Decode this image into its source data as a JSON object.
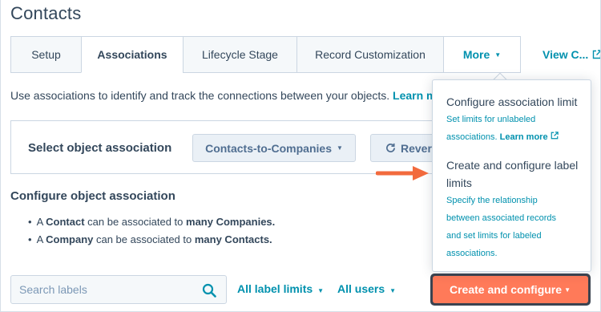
{
  "page": {
    "title": "Contacts"
  },
  "tabs": [
    {
      "label": "Setup"
    },
    {
      "label": "Associations"
    },
    {
      "label": "Lifecycle Stage"
    },
    {
      "label": "Record Customization"
    },
    {
      "label": "More"
    }
  ],
  "view_tab": {
    "label": "View C..."
  },
  "description": {
    "text": "Use associations to identify and track the connections between your objects.",
    "link": "Learn mor"
  },
  "select_association": {
    "label": "Select object association",
    "dropdown_value": "Contacts-to-Companies",
    "reverse_label": "Revers"
  },
  "configure": {
    "title": "Configure object association",
    "bullets": [
      {
        "prefix": "A ",
        "subject": "Contact",
        "middle": " can be associated to ",
        "object": "many Companies."
      },
      {
        "prefix": "A ",
        "subject": "Company",
        "middle": " can be associated to ",
        "object": "many Contacts."
      }
    ]
  },
  "search": {
    "placeholder": "Search labels",
    "value": ""
  },
  "filters": {
    "label_limits": "All label limits",
    "users": "All users"
  },
  "primary_button": {
    "label": "Create and configure"
  },
  "menu": {
    "item1": {
      "title": "Configure association limit",
      "desc_line1": "Set limits for unlabeled",
      "desc_line2": "associations.",
      "learn_more": "Learn more"
    },
    "item2": {
      "title_line1": "Create and configure label",
      "title_line2": "limits",
      "desc_lines": [
        "Specify the relationship",
        "between associated records",
        "and set limits for labeled",
        "associations."
      ]
    }
  },
  "colors": {
    "accent": "#0091ae",
    "primary": "#ff7a59",
    "text": "#33475b",
    "arrow": "#f26a3d"
  },
  "icons": {
    "search": "search-icon",
    "external": "external-link-icon",
    "reverse": "refresh-icon",
    "caret": "caret-down-icon",
    "annotation_arrow": "arrow-right-icon"
  }
}
